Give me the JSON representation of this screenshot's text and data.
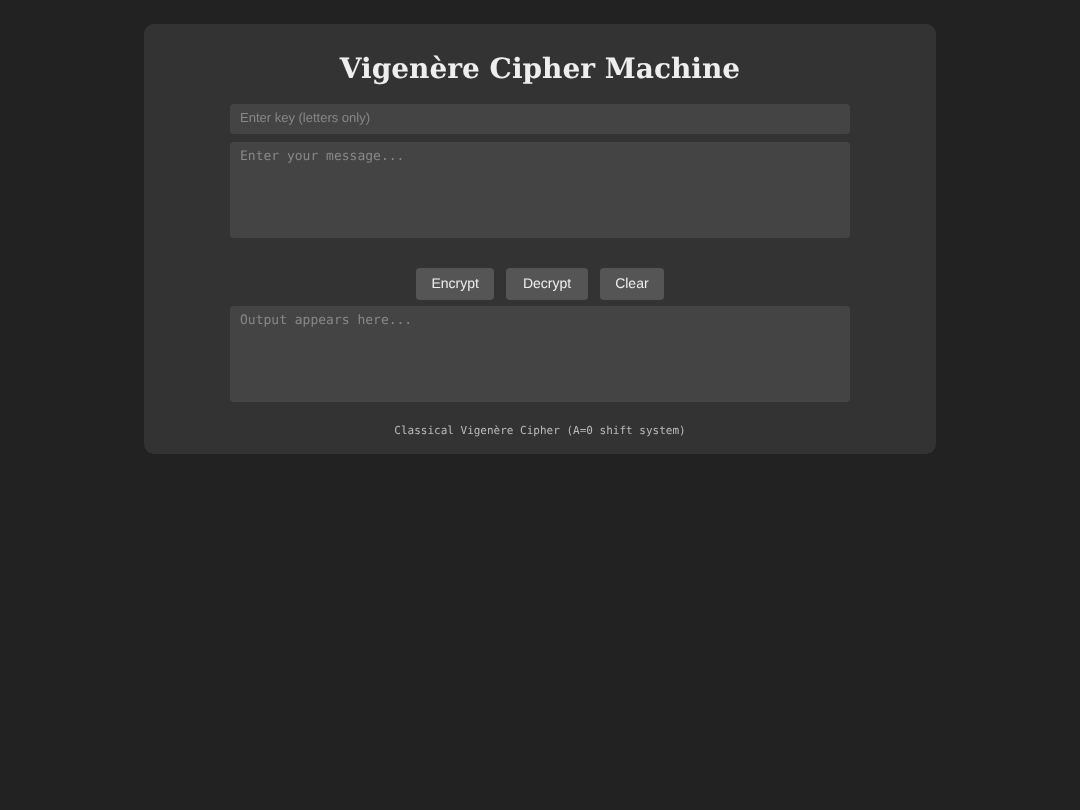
{
  "title": "Vigenère Cipher Machine",
  "key_field": {
    "placeholder": "Enter key (letters only)"
  },
  "message_field": {
    "placeholder": "Enter your message..."
  },
  "buttons": [
    "Encrypt",
    "Decrypt",
    "Clear"
  ],
  "output_field": {
    "placeholder": "Output appears here..."
  },
  "footer": "Classical Vigenère Cipher (A=0 shift system)"
}
